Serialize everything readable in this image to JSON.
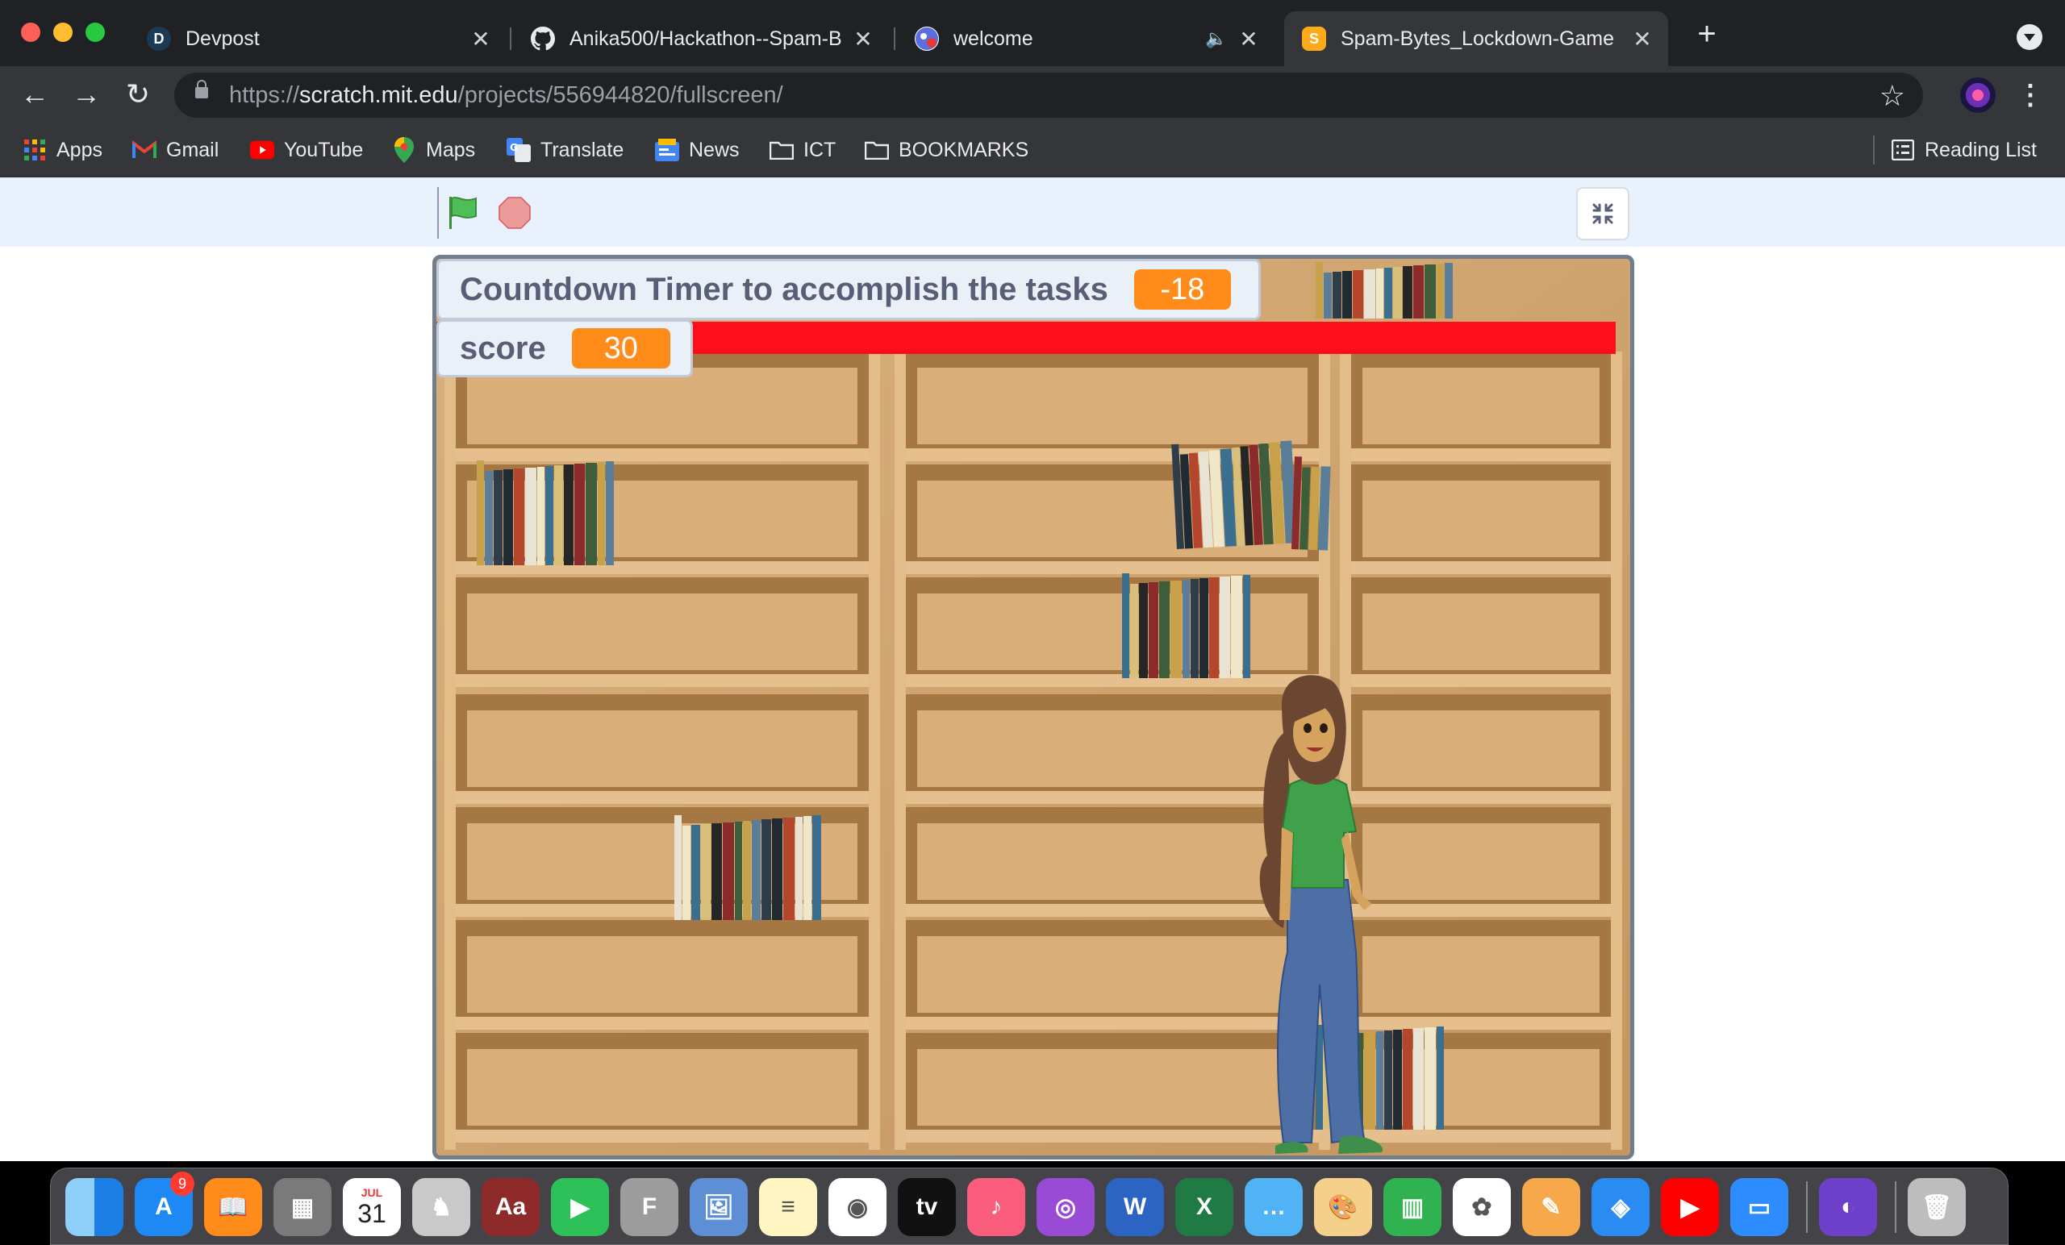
{
  "browser": {
    "tabs": [
      {
        "title": "Devpost",
        "favicon": "devpost-icon",
        "favicon_letter": "D"
      },
      {
        "title": "Anika500/Hackathon--Spam-B",
        "favicon": "github-icon"
      },
      {
        "title": "welcome",
        "favicon": "game-icon",
        "audio": "speaker-icon"
      },
      {
        "title": "Spam-Bytes_Lockdown-Game",
        "favicon": "scratch-icon",
        "active": true
      }
    ],
    "close_glyph": "✕",
    "new_tab_glyph": "+",
    "address": {
      "scheme": "https://",
      "host": "scratch.mit.edu",
      "path": "/projects/556944820/fullscreen/"
    },
    "bookmarks": [
      {
        "label": "Apps",
        "icon": "apps-grid-icon"
      },
      {
        "label": "Gmail",
        "icon": "gmail-icon"
      },
      {
        "label": "YouTube",
        "icon": "youtube-icon"
      },
      {
        "label": "Maps",
        "icon": "maps-icon"
      },
      {
        "label": "Translate",
        "icon": "translate-icon"
      },
      {
        "label": "News",
        "icon": "news-icon"
      },
      {
        "label": "ICT",
        "icon": "folder-icon"
      },
      {
        "label": "BOOKMARKS",
        "icon": "folder-icon"
      }
    ],
    "reading_list": "Reading List"
  },
  "scratch": {
    "monitors": {
      "timer_label": "Countdown Timer to accomplish the tasks",
      "timer_value": "-18",
      "score_label": "score",
      "score_value": "30"
    },
    "colors": {
      "monitor_value": "#ff8c1a",
      "red_bar": "#ff0d1a",
      "flag": "#45a844",
      "stop": "#ec9a9a"
    },
    "stage_scene": "bookshelf-with-girl-sprite"
  },
  "dock": {
    "badge_count": "9",
    "calendar_month": "JUL",
    "calendar_day": "31",
    "apps": [
      "finder-icon",
      "app-store-icon",
      "books-icon",
      "calculator-icon",
      "calendar-icon",
      "chess-icon",
      "dictionary-icon",
      "facetime-icon",
      "font-book-icon",
      "preview-icon",
      "notes-icon",
      "chrome-icon",
      "apple-tv-icon",
      "music-icon",
      "podcasts-icon",
      "word-icon",
      "excel-icon",
      "messages-icon",
      "art-icon",
      "numbers-icon",
      "photos-icon",
      "pages-icon",
      "safari-icon",
      "youtube-music-icon",
      "zoom-icon",
      "github-desktop-icon",
      "trash-icon"
    ]
  }
}
